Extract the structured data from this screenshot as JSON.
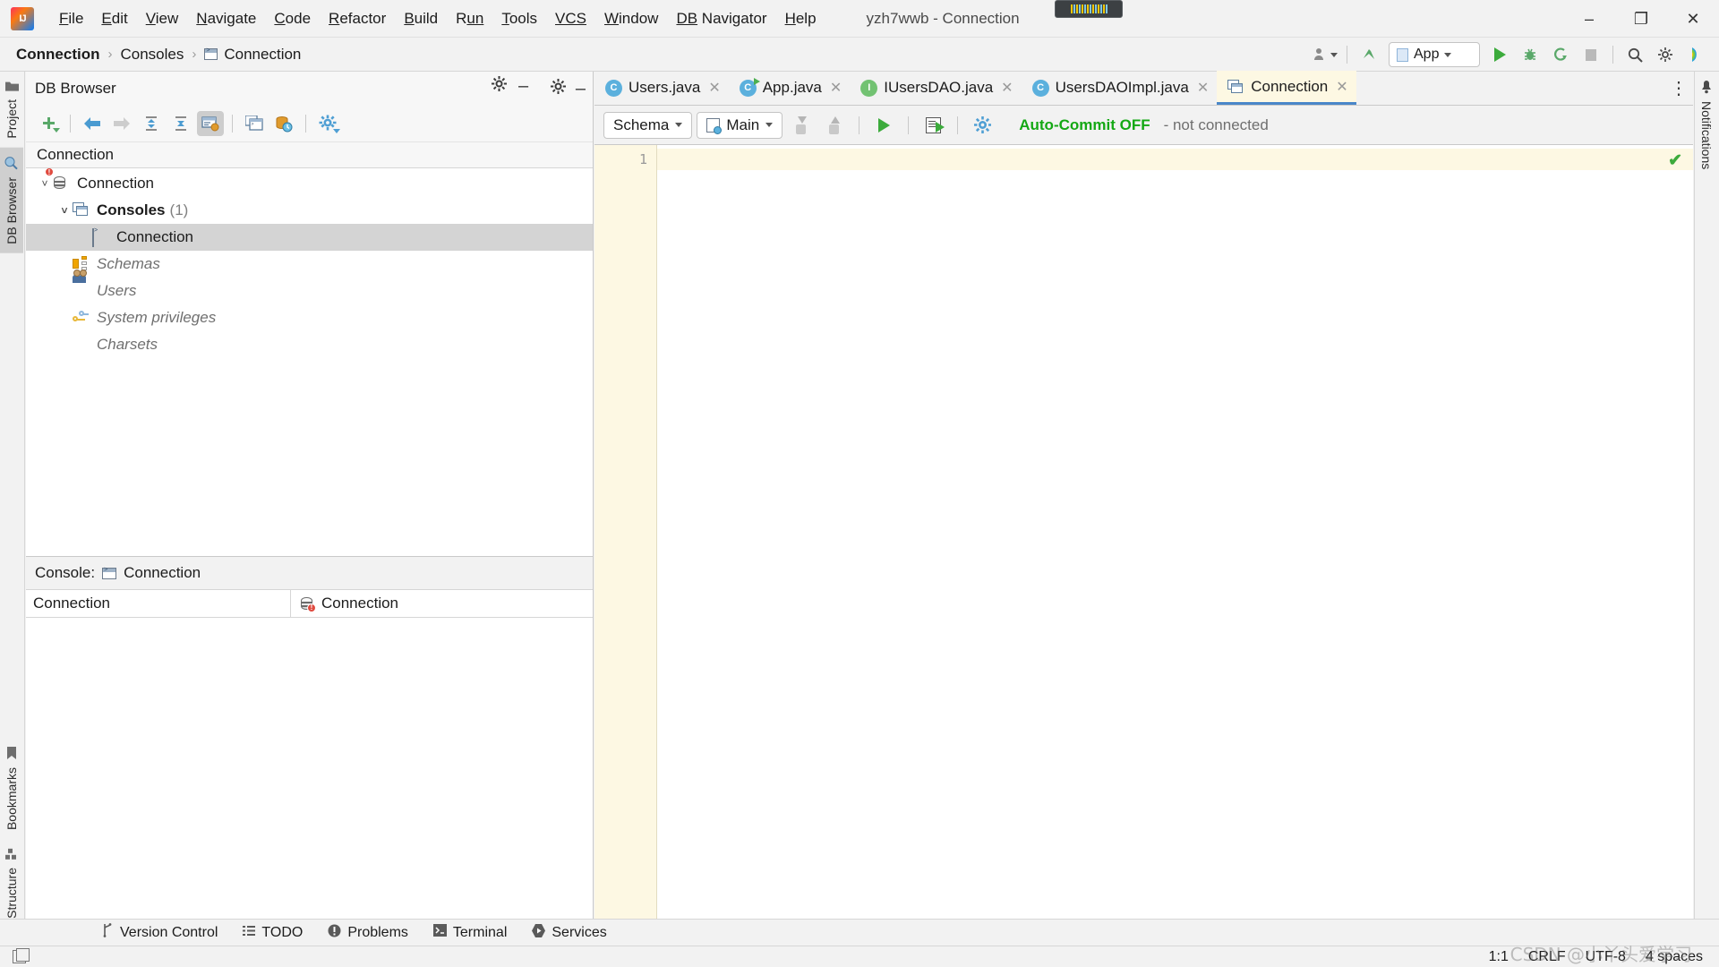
{
  "titlebar": {
    "logo": "intellij-logo",
    "menus": [
      {
        "first": "F",
        "rest": "ile"
      },
      {
        "first": "E",
        "rest": "dit"
      },
      {
        "first": "V",
        "rest": "iew"
      },
      {
        "first": "N",
        "rest": "avigate"
      },
      {
        "first": "C",
        "rest": "ode"
      },
      {
        "first": "R",
        "rest": "efactor"
      },
      {
        "first": "B",
        "rest": "uild"
      },
      {
        "first": "R",
        "rest": "un"
      },
      {
        "first": "T",
        "rest": "ools"
      },
      {
        "first": "VCS",
        "rest": ""
      },
      {
        "first": "W",
        "rest": "indow"
      },
      {
        "first": "DB",
        "rest": " Navigator"
      },
      {
        "first": "H",
        "rest": "elp"
      }
    ],
    "window_title": "yzh7wwb - Connection",
    "minimize": "–",
    "maximize": "❐",
    "close": "✕"
  },
  "navbar": {
    "crumbs": [
      {
        "label": "Connection",
        "icon": ""
      },
      {
        "label": "Consoles",
        "icon": ""
      },
      {
        "label": "Connection",
        "icon": "console-icon"
      }
    ],
    "separator": "›",
    "run_config": "App",
    "actions": [
      "user-icon",
      "update-icon",
      "run-icon",
      "debug-icon",
      "run-coverage-icon",
      "stop-icon",
      "search-icon",
      "settings-icon",
      "ai-assistant-icon"
    ]
  },
  "left_strip": {
    "project_label": "Project",
    "db_browser_label": "DB Browser",
    "bookmarks_label": "Bookmarks",
    "structure_label": "Structure"
  },
  "right_strip": {
    "notifications_label": "Notifications"
  },
  "db_browser": {
    "title": "DB Browser",
    "settings_icon": "gear-icon",
    "hide_icon": "minimize-icon",
    "toolbar": [
      "add-icon",
      "back-icon",
      "forward-icon",
      "expand-all-icon",
      "collapse-all-icon",
      "show-objects-icon",
      "open-console-icon",
      "session-browser-icon",
      "settings-icon"
    ],
    "filter_label": "Connection",
    "tree": [
      {
        "label": "Connection",
        "icon": "database-error-icon",
        "indent": 0,
        "expanded": true,
        "style": "normal",
        "count": ""
      },
      {
        "label": "Consoles",
        "icon": "consoles-icon",
        "indent": 1,
        "expanded": true,
        "style": "bold",
        "count": "(1)"
      },
      {
        "label": "Connection",
        "icon": "console-icon",
        "indent": 2,
        "expanded": null,
        "style": "selected",
        "count": ""
      },
      {
        "label": "Schemas",
        "icon": "schemas-icon",
        "indent": 1,
        "expanded": null,
        "style": "faded",
        "count": ""
      },
      {
        "label": "Users",
        "icon": "users-icon",
        "indent": 1,
        "expanded": null,
        "style": "faded",
        "count": ""
      },
      {
        "label": "System privileges",
        "icon": "privileges-icon",
        "indent": 1,
        "expanded": null,
        "style": "faded",
        "count": ""
      },
      {
        "label": "Charsets",
        "icon": "none",
        "indent": 1,
        "expanded": null,
        "style": "faded",
        "count": ""
      }
    ],
    "console_section": {
      "label": "Console:",
      "name": "Connection",
      "row_left": "Connection",
      "row_right": "Connection"
    }
  },
  "editor": {
    "tabs": [
      {
        "label": "Users.java",
        "icon": "java-class-icon",
        "active": false,
        "closable": true
      },
      {
        "label": "App.java",
        "icon": "java-class-runnable-icon",
        "active": false,
        "closable": true
      },
      {
        "label": "IUsersDAO.java",
        "icon": "java-interface-icon",
        "active": false,
        "closable": true
      },
      {
        "label": "UsersDAOImpl.java",
        "icon": "java-class-icon",
        "active": false,
        "closable": true
      },
      {
        "label": "Connection",
        "icon": "consoles-icon",
        "active": true,
        "closable": true
      }
    ],
    "tab_overflow": "⋮",
    "sql_toolbar": {
      "schema_label": "Schema",
      "session_label": "Main",
      "commit_icon": "commit-icon",
      "rollback_icon": "rollback-icon",
      "execute_icon": "execute-icon",
      "execute_script_icon": "execute-script-icon",
      "settings_icon": "settings-gear-icon",
      "autocommit_label": "Auto-Commit OFF",
      "connection_status": "- not connected"
    },
    "line_numbers": [
      "1"
    ],
    "code_text": "",
    "inspection_status": "✔"
  },
  "toolwindows": [
    {
      "label": "Version Control",
      "icon": "branch-icon"
    },
    {
      "label": "TODO",
      "icon": "list-icon"
    },
    {
      "label": "Problems",
      "icon": "problems-icon"
    },
    {
      "label": "Terminal",
      "icon": "terminal-icon"
    },
    {
      "label": "Services",
      "icon": "services-icon"
    }
  ],
  "statusbar": {
    "position": "1:1",
    "line_separator": "CRLF",
    "encoding": "UTF-8",
    "indent": "4 spaces",
    "watermark": "CSDN @小丫头爱学习"
  }
}
